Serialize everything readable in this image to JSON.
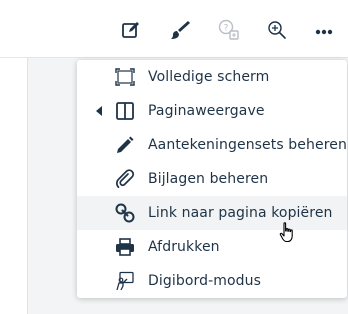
{
  "toolbar": {
    "buttons": [
      {
        "icon": "edit-note-icon"
      },
      {
        "icon": "brush-icon"
      },
      {
        "icon": "help-translate-icon"
      },
      {
        "icon": "zoom-in-icon"
      },
      {
        "icon": "more-options-icon"
      }
    ]
  },
  "menu": {
    "items": [
      {
        "label": "Volledige scherm",
        "icon": "fullscreen-icon"
      },
      {
        "label": "Paginaweergave",
        "icon": "page-view-icon",
        "has_submenu": true
      },
      {
        "label": "Aantekeningensets beheren",
        "icon": "pencil-icon"
      },
      {
        "label": "Bijlagen beheren",
        "icon": "paperclip-icon"
      },
      {
        "label": "Link naar pagina kopiëren",
        "icon": "link-icon",
        "hovered": true
      },
      {
        "label": "Afdrukken",
        "icon": "printer-icon"
      },
      {
        "label": "Digibord-modus",
        "icon": "whiteboard-icon"
      }
    ]
  },
  "colors": {
    "icon": "#1f3347",
    "icon_muted": "#b8bfc6",
    "text": "#1f3347",
    "hover_bg": "#f2f3f4"
  }
}
